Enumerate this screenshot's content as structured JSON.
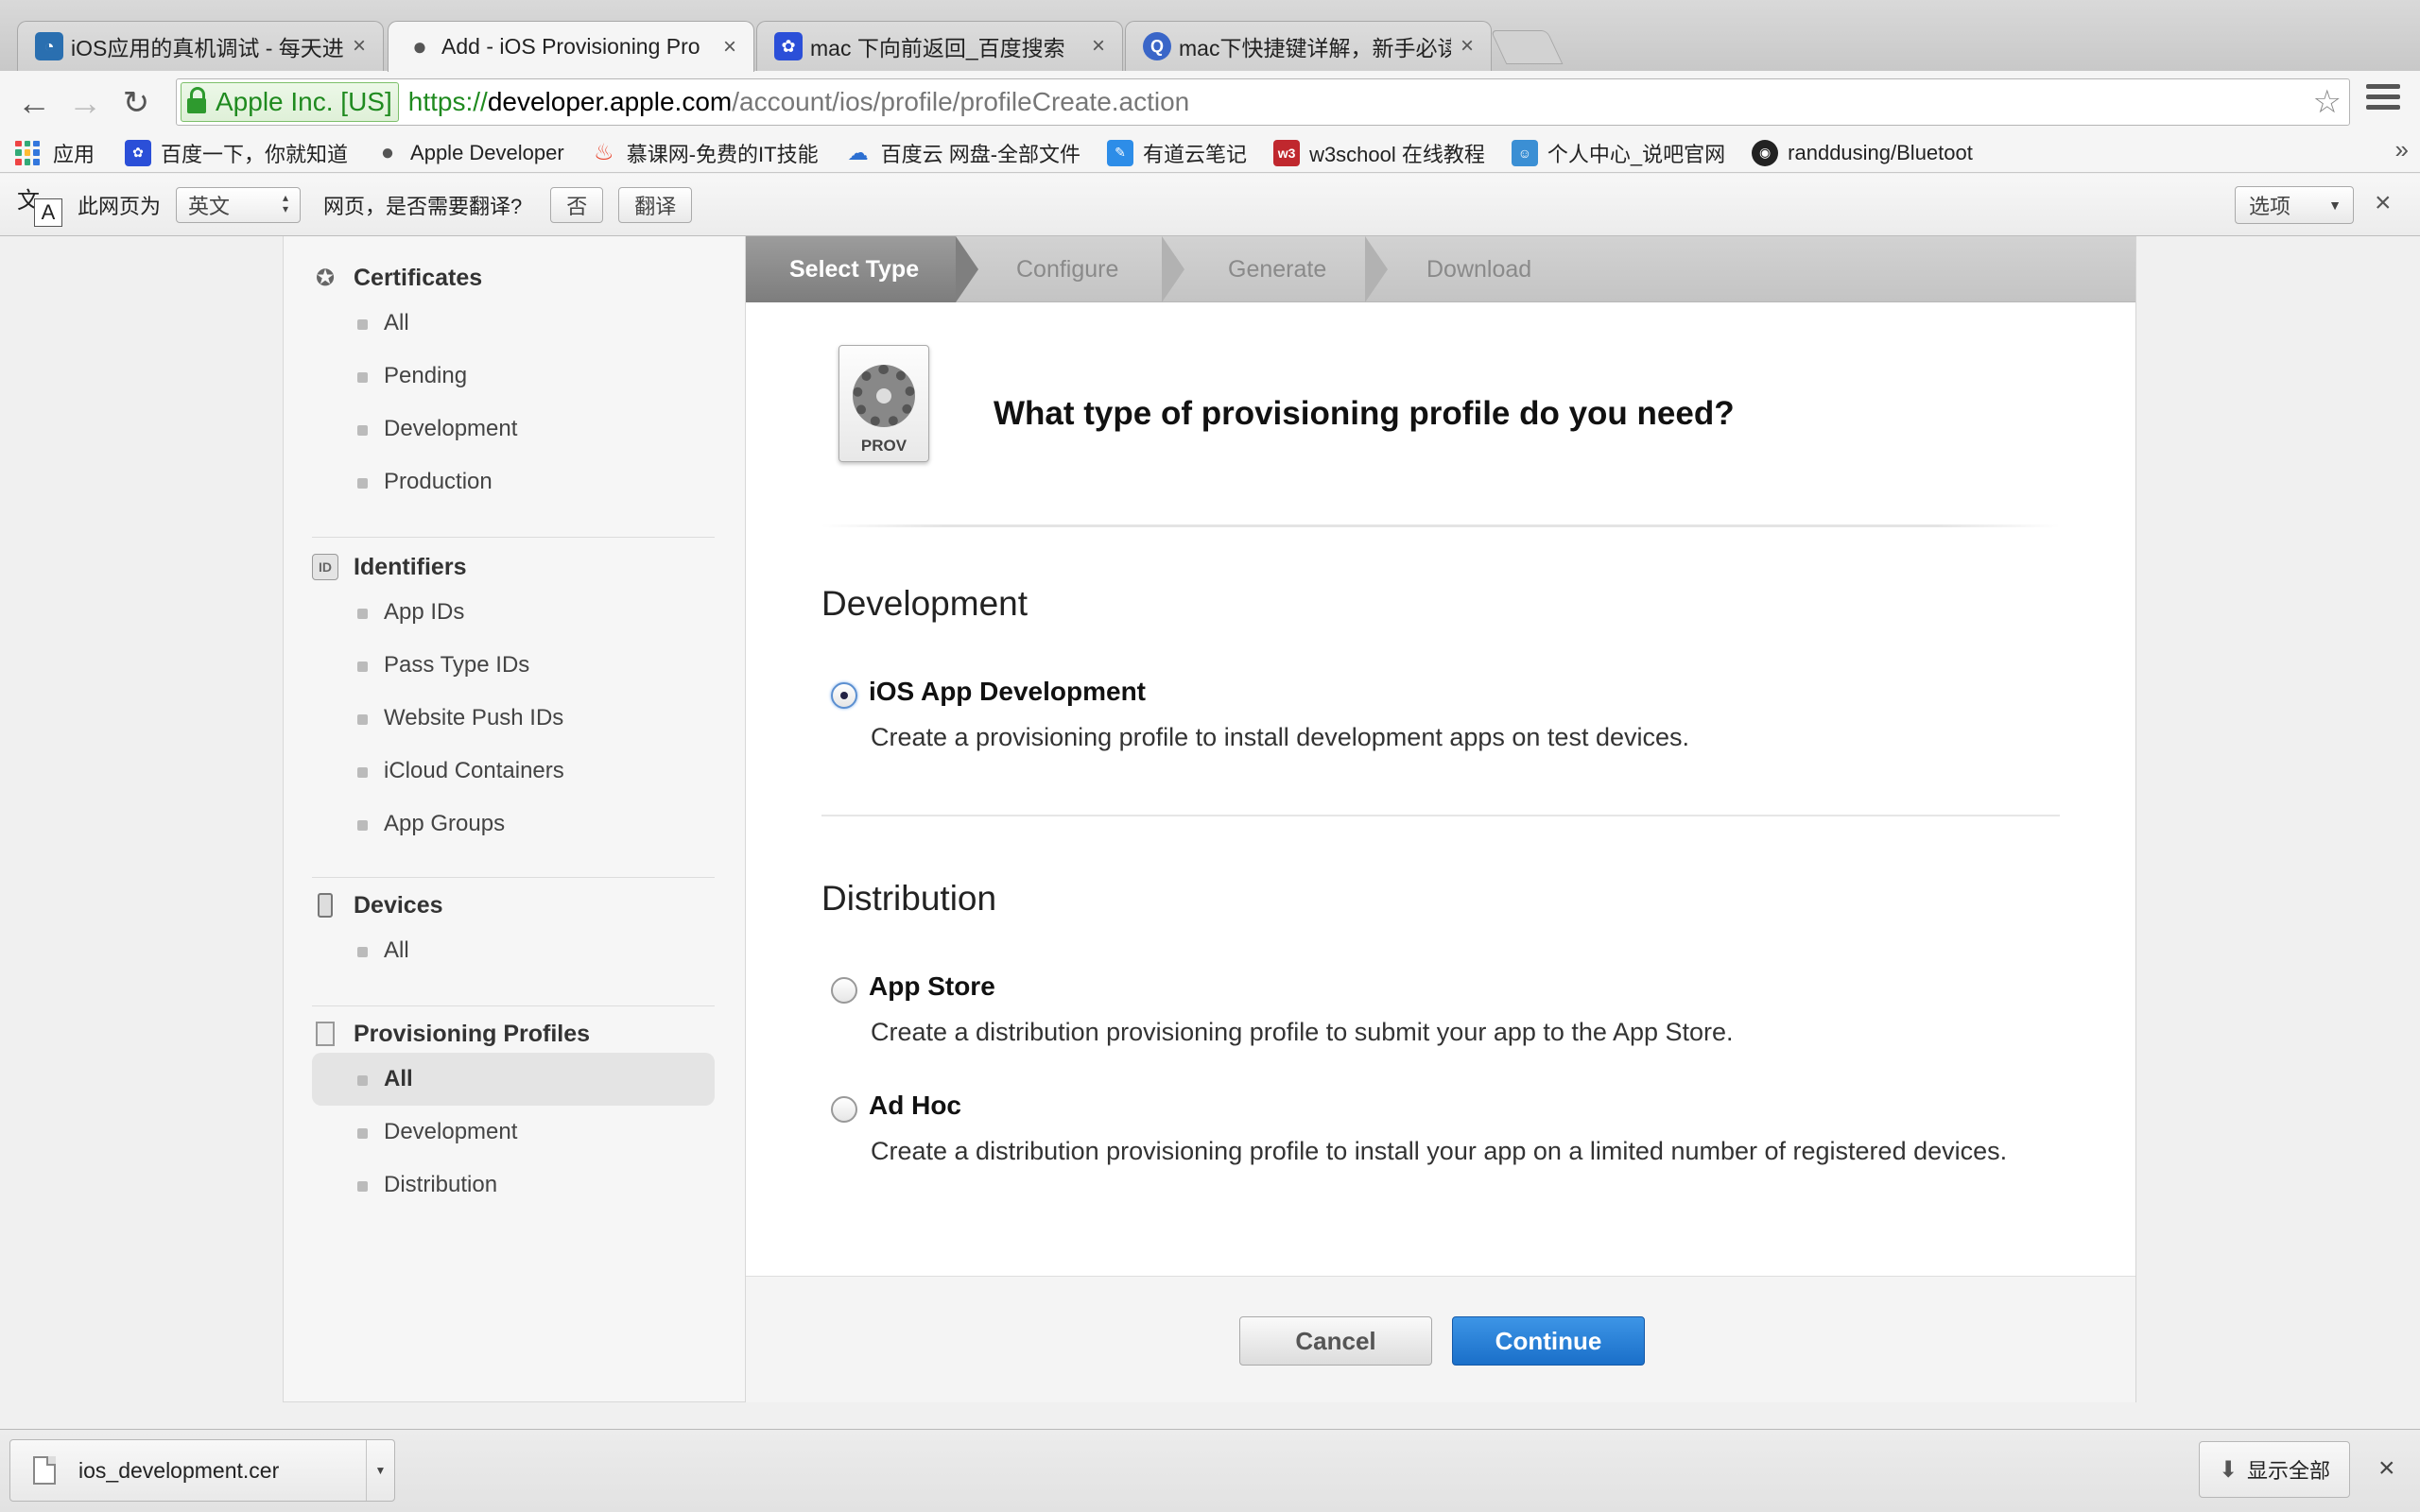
{
  "tabs": [
    {
      "title": "iOS应用的真机调试 - 每天进",
      "icon": "clock-blue-icon",
      "active": false
    },
    {
      "title": "Add - iOS Provisioning Pro",
      "icon": "apple-icon",
      "active": true
    },
    {
      "title": "mac 下向前返回_百度搜索",
      "icon": "baidu-paw-icon",
      "active": false
    },
    {
      "title": "mac下快捷键详解，新手必读",
      "icon": "search-q-icon",
      "active": false
    }
  ],
  "address": {
    "ev_name": "Apple Inc. [US]",
    "scheme": "https://",
    "host": "developer.apple.com",
    "path": "/account/ios/profile/profileCreate.action"
  },
  "bookmarks": [
    {
      "label": "应用",
      "icon": "apps-grid-icon"
    },
    {
      "label": "百度一下，你就知道",
      "icon": "baidu-paw-icon"
    },
    {
      "label": "Apple Developer",
      "icon": "apple-icon"
    },
    {
      "label": "慕课网-免费的IT技能",
      "icon": "flame-icon"
    },
    {
      "label": "百度云 网盘-全部文件",
      "icon": "cloud-icon"
    },
    {
      "label": "有道云笔记",
      "icon": "note-icon"
    },
    {
      "label": "w3school 在线教程",
      "icon": "w3-icon"
    },
    {
      "label": "个人中心_说吧官网",
      "icon": "avatar-icon"
    },
    {
      "label": "randdusing/Bluetoot",
      "icon": "github-icon"
    }
  ],
  "translate": {
    "prefix": "此网页为",
    "language": "英文",
    "question": "网页，是否需要翻译?",
    "no_label": "否",
    "translate_label": "翻译",
    "options_label": "选项"
  },
  "sidebar": {
    "sections": [
      {
        "title": "Certificates",
        "icon": "certificate-icon",
        "items": [
          "All",
          "Pending",
          "Development",
          "Production"
        ]
      },
      {
        "title": "Identifiers",
        "icon": "id-badge-icon",
        "items": [
          "App IDs",
          "Pass Type IDs",
          "Website Push IDs",
          "iCloud Containers",
          "App Groups"
        ]
      },
      {
        "title": "Devices",
        "icon": "device-icon",
        "items": [
          "All"
        ]
      },
      {
        "title": "Provisioning Profiles",
        "icon": "document-icon",
        "items": [
          "All",
          "Development",
          "Distribution"
        ]
      }
    ],
    "selected": "Provisioning Profiles / All"
  },
  "steps": [
    "Select Type",
    "Configure",
    "Generate",
    "Download"
  ],
  "main": {
    "icon_label": "PROV",
    "heading": "What type of provisioning profile do you need?",
    "development_title": "Development",
    "distribution_title": "Distribution",
    "options": [
      {
        "label": "iOS App Development",
        "desc": "Create a provisioning profile to install development apps on test devices.",
        "checked": true
      },
      {
        "label": "App Store",
        "desc": "Create a distribution provisioning profile to submit your app to the App Store.",
        "checked": false
      },
      {
        "label": "Ad Hoc",
        "desc": "Create a distribution provisioning profile to install your app on a limited number of registered devices.",
        "checked": false
      }
    ],
    "cancel_label": "Cancel",
    "continue_label": "Continue"
  },
  "downloads": {
    "file_name": "ios_development.cer",
    "show_all_label": "显示全部"
  },
  "colors": {
    "continue_blue": "#1a6fc9",
    "ev_green": "#1f8a1f"
  }
}
